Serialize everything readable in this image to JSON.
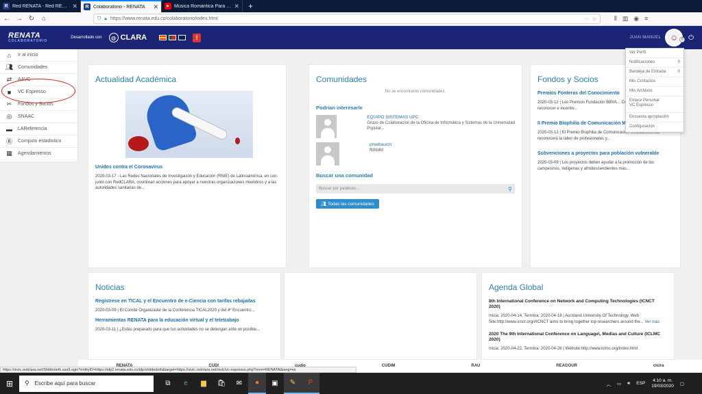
{
  "browser": {
    "tabs": [
      {
        "title": "Red RENATA - Red RENATA Red",
        "icon": "renata-favicon-icon",
        "active": false
      },
      {
        "title": "Colaboratorio - RENATA",
        "icon": "renata-favicon-icon",
        "active": true
      },
      {
        "title": "Música Romántica Para Trabaja",
        "icon": "youtube-favicon-icon",
        "active": false
      }
    ],
    "url": "https://www.renata.edu.co/colaboratorio/index.html",
    "url_more": "···"
  },
  "header": {
    "logo": "RENATA",
    "logo_sub": "COLABORATORIO",
    "developed_by": "Desarrollado con",
    "clara": "CLARA",
    "warning": "!",
    "user_name": "JUAN MANUEL",
    "avatar_badge": "0"
  },
  "sidebar": {
    "items": [
      {
        "label": "Ir al inicio",
        "icon": "home-icon"
      },
      {
        "label": "Comunidades",
        "icon": "users-icon"
      },
      {
        "label": "AAVC",
        "icon": "arrows-icon"
      },
      {
        "label": "VC Espresso",
        "icon": "video-camera-icon"
      },
      {
        "label": "Fondos y Socios",
        "icon": "scissors-icon"
      },
      {
        "label": "SNAAC",
        "icon": "globe-icon"
      },
      {
        "label": "LAReferencia",
        "icon": "minus-icon"
      },
      {
        "label": "Computo estadistico",
        "icon": "r-icon"
      },
      {
        "label": "Agendamientos",
        "icon": "calendar-icon"
      }
    ]
  },
  "academic": {
    "title": "Actualidad Académica",
    "news_title": "Unidos contra el Coronavirus",
    "news_date": "2020-03-17",
    "news_text": "Las Redes Nacionales de Investigación y Educación (RNIE) de Latinoamérica, en con-junto con RedCLARA, coordinan acciones para apoyar a nuestras organizaciones miembros y a las autoridades sanitarias de..."
  },
  "communities": {
    "title": "Comunidades",
    "empty": "No se encontraron comunidades.",
    "suggest_title": "Podrían interesarle",
    "suggestions": [
      {
        "name": "EQUIPO SISTEMAS UPC",
        "desc": "Grupo de Colaboracion de la Oficina de Informática y Sistemas de la Universidad Popular..."
      },
      {
        "name": "pruebaucm",
        "desc": "ffdfddfd"
      }
    ],
    "search_title": "Buscar una comunidad",
    "search_placeholder": "Buscar por palabras...",
    "all_button": "Todas las comunidades"
  },
  "funds": {
    "title": "Fondos y Socios",
    "items": [
      {
        "title": "Premios Fonteras del Conocimiento",
        "date": "2020-03-12",
        "text": "Los Premios Fundación BBVA... Conocimiento quieren reconocer e incentiv..."
      },
      {
        "title": "II Premio Biophilia de Comunicación M...",
        "date": "2020-03-12",
        "text": "El Premio Biophilia de Comunicación Medioambiental reconocerá la labor de profesionales y..."
      },
      {
        "title": "Subvenciones a proyectos para población vulnerable",
        "date": "2020-03-09",
        "text": "Los proyectos deben ayudar a la promoción de los campesinos, indígenas y afrodescendientes más..."
      }
    ]
  },
  "news": {
    "title": "Noticias",
    "items": [
      {
        "title": "Regístrese en TICAL y el Encuentro de e-Ciencia con tarifas rebajadas",
        "date": "2020-03-09",
        "text": "El Comité Organizador de la Conferencia TICAL2020 y del 4º Encuentro..."
      },
      {
        "title": "Herramientas RENATA para la educación virtual y el teletrabajo",
        "date": "2020-03-11",
        "text": "¿Estás preparado para que tus actividades no se detengan ante un posible..."
      }
    ]
  },
  "agenda": {
    "title": "Agenda Global",
    "items": [
      {
        "title": "8th International Conference on Network and Computing Technologies (ICNCT 2020)",
        "text": "Inicia: 2020-04-14, Termina: 2020-04-18 | Auckland University Of Technology. Web Site:http://www.icnct.org/#ICNCT aims to bring together top researchers around the...",
        "more": "Ver más"
      },
      {
        "title": "2020 The 9th International Conference on Language\\, Medias and Culture (ICLMC 2020)",
        "text": "Inicia: 2020-04-22, Termina: 2020-04-26 | Website:http://www.iclmc.org/index.html",
        "more": ""
      }
    ]
  },
  "dropdown": {
    "items": [
      {
        "label": "Ver Perfil",
        "count": ""
      },
      {
        "label": "Notificaciones",
        "count": "0"
      },
      {
        "label": "Bandeja de Entrada",
        "count": "0"
      },
      {
        "label": "Mis Contactos",
        "count": ""
      },
      {
        "label": "Mis Archivos",
        "count": ""
      },
      {
        "label": "Enlace Personal VC Espresso",
        "count": ""
      },
      {
        "label": "Encuesta apropiación",
        "count": ""
      },
      {
        "label": "Configuración",
        "count": ""
      }
    ]
  },
  "statusbar": "https://sivic.redclara.net/Shibboleth.sso/Login?entityID=https://idp2.renata.edu.co/idp/shibboleth&target=https://sivic.redclara.net/sivic/vc-espresso.php?nren=RENATA&lang=es",
  "logos": [
    "RENATA",
    "CUDI",
    "cudio",
    "CUDIM",
    "RAU",
    "REAGOUR",
    "clcira"
  ],
  "taskbar": {
    "search_placeholder": "Escribe aquí para buscar",
    "language": "ESP",
    "time": "4:10 a. m.",
    "date": "19/03/2020"
  }
}
